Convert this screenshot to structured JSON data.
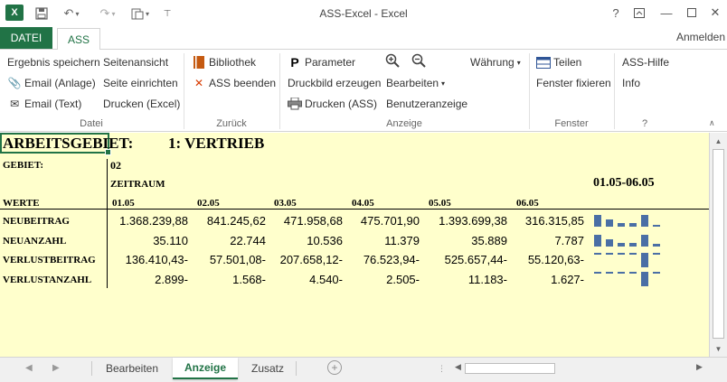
{
  "window": {
    "title": "ASS-Excel - Excel",
    "logo": "X",
    "help": "?",
    "user": "Anmelden"
  },
  "tabs": {
    "file": "DATEI",
    "ass": "ASS"
  },
  "ribbon": {
    "datei": {
      "label": "Datei",
      "save_result": "Ergebnis speichern",
      "email_attachment": "Email (Anlage)",
      "email_text": "Email (Text)",
      "page_view": "Seitenansicht",
      "page_setup": "Seite einrichten",
      "print_excel": "Drucken (Excel)"
    },
    "zurueck": {
      "label": "Zurück",
      "library": "Bibliothek",
      "exit_ass": "ASS beenden"
    },
    "anzeige": {
      "label": "Anzeige",
      "parameter": "Parameter",
      "print_image": "Druckbild erzeugen",
      "print_ass": "Drucken (ASS)",
      "edit": "Bearbeiten",
      "user_view": "Benutzeranzeige",
      "currency": "Währung"
    },
    "fenster": {
      "label": "Fenster",
      "split": "Teilen",
      "freeze": "Fenster fixieren"
    },
    "hilfe": {
      "label": "?",
      "ass_help": "ASS-Hilfe",
      "info": "Info"
    }
  },
  "sheet": {
    "title_prefix": "ARBEITSGEBIET:",
    "title_value": "1: VERTRIEB",
    "area_label": "GEBIET:",
    "area_value": "02",
    "period_label": "ZEITRAUM",
    "period_range": "01.05-06.05",
    "values_label": "WERTE",
    "dates": [
      "01.05",
      "02.05",
      "03.05",
      "04.05",
      "05.05",
      "06.05"
    ],
    "rows": [
      {
        "label": "NEUBEITRAG",
        "values": [
          "1.368.239,88",
          "841.245,62",
          "471.958,68",
          "475.701,90",
          "1.393.699,38",
          "316.315,85"
        ]
      },
      {
        "label": "NEUANZAHL",
        "values": [
          "35.110",
          "22.744",
          "10.536",
          "11.379",
          "35.889",
          "7.787"
        ]
      },
      {
        "label": "VERLUSTBEITRAG",
        "values": [
          "136.410,43-",
          "57.501,08-",
          "207.658,12-",
          "76.523,94-",
          "525.657,44-",
          "55.120,63-"
        ]
      },
      {
        "label": "VERLUSTANZAHL",
        "values": [
          "2.899-",
          "1.568-",
          "4.540-",
          "2.505-",
          "11.183-",
          "1.627-"
        ]
      }
    ]
  },
  "sheet_tabs": [
    "Bearbeiten",
    "Anzeige",
    "Zusatz"
  ],
  "active_sheet_tab": "Anzeige"
}
